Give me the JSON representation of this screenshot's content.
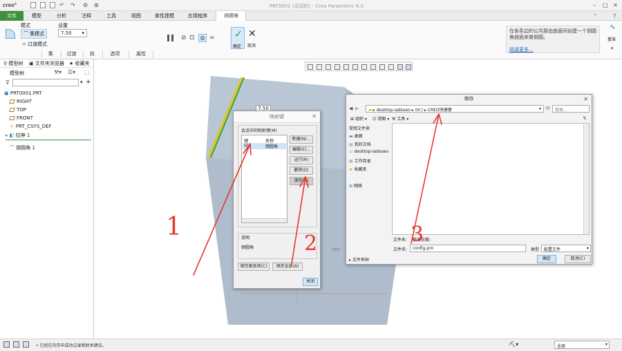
{
  "app": {
    "logo": "creo°",
    "window_title": "PRT0001 (活动的) - Creo Parametric 6.0"
  },
  "menu": {
    "tabs": [
      "文件",
      "模型",
      "分析",
      "注释",
      "工具",
      "视图",
      "柔性建模",
      "应用程序"
    ],
    "active_tab": "倒圆角"
  },
  "ribbon": {
    "mode_label": "模式",
    "set_mode": "集模式",
    "transition_mode": "过渡模式",
    "settings_label": "设置",
    "radius_value": "7.50",
    "subtabs": [
      "集",
      "过渡",
      "段",
      "选项",
      "属性"
    ],
    "ok_label": "确定",
    "cancel_label": "取消",
    "base_label": "基准",
    "hint_text": "在各条边的公共那由曲面间创建一个倒圆角曲面来做倒圆。",
    "hint_link": "阅读更多..."
  },
  "left_panel": {
    "tabs": [
      "模型树",
      "文件夹浏览器",
      "收藏夹"
    ],
    "tree_title": "模型树",
    "tree_items": [
      "PRT0001.PRT",
      "RIGHT",
      "TOP",
      "FRONT",
      "PRT_CSYS_DEF",
      "拉伸 1",
      "倒圆角 1"
    ]
  },
  "graphics": {
    "dimension_value": "7.50",
    "prt_label": "PRT"
  },
  "mapkey_dialog": {
    "title": "映射键",
    "group_label": "会话中的映射键(M)",
    "col_key": "键",
    "col_name": "名称",
    "row_key": "sz",
    "row_name": "倒圆角",
    "buttons": [
      "新建(N)...",
      "编辑(E)...",
      "运行(R)",
      "删除(D)",
      "保存(S)"
    ],
    "desc_label": "说明",
    "desc_text": "倒圆角",
    "save_changed": "保存更改项(C)",
    "save_all": "保存全部(A)",
    "close": "关闭"
  },
  "save_dialog": {
    "title": "保存",
    "path": [
      "desktop-iadsoeo",
      "(H:)",
      "CREO快捷键"
    ],
    "search_placeholder": "搜索...",
    "toolbar": [
      "组织",
      "视图",
      "工具"
    ],
    "sidebar_header": "常用文件夹",
    "sidebar_items": [
      "桌面",
      "我的文档",
      "desktop-iadsoeo",
      "工作目录",
      "收藏夹"
    ],
    "network": "网络",
    "filename_label": "文件名:",
    "modified_label": "修改日期:",
    "filename_field_label": "文件名:",
    "filename_value": "config.pro",
    "type_label": "类型",
    "type_value": "配置文件",
    "folder_tree": "文件夹树",
    "ok": "确定",
    "cancel": "取消(C)"
  },
  "status": {
    "message": "已经在内存中成功记录映射关键设。",
    "filter_value": "全部"
  },
  "annotations": {
    "labels": [
      "1",
      "2",
      "3"
    ],
    "color": "#e8342b"
  }
}
